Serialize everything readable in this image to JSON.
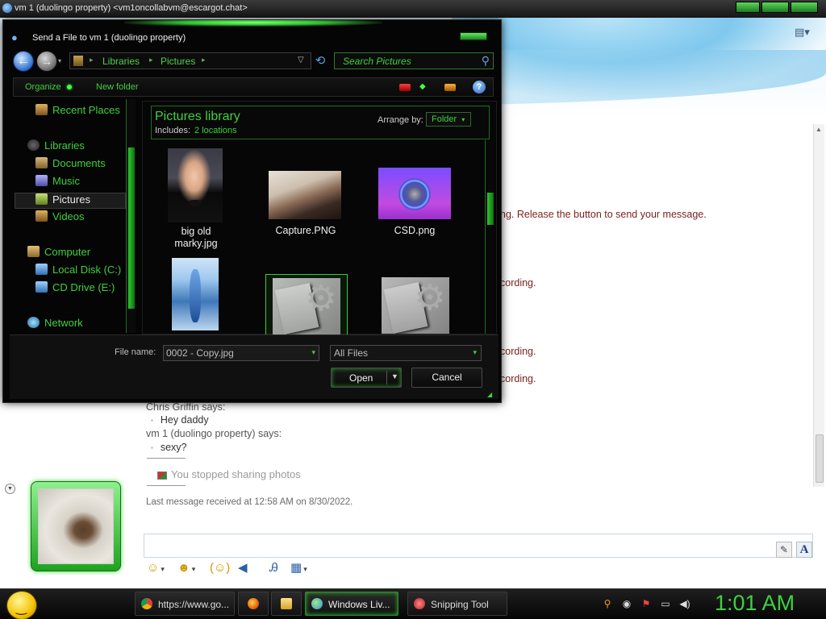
{
  "window": {
    "title": "vm 1 (duolingo property) <vm1oncollabvm@escargot.chat>"
  },
  "chat": {
    "system_messages": [
      "ng. Release the button to send your message.",
      "cording.",
      "cording.",
      "cording."
    ],
    "messages": [
      {
        "sender": "Chris Griffin says:",
        "text": "Hey daddy"
      },
      {
        "sender": "vm 1 (duolingo property) says:",
        "text": "sexy?"
      }
    ],
    "info": "You stopped sharing photos",
    "last_received": "Last message received at 12:58 AM on 8/30/2022."
  },
  "dialog": {
    "title": "Send a File to vm 1 (duolingo property)",
    "breadcrumb": [
      "Libraries",
      "Pictures"
    ],
    "search_placeholder": "Search Pictures",
    "toolbar": {
      "organize": "Organize",
      "new_folder": "New folder"
    },
    "nav": {
      "recent": "Recent Places",
      "libraries": "Libraries",
      "documents": "Documents",
      "music": "Music",
      "pictures": "Pictures",
      "videos": "Videos",
      "computer": "Computer",
      "local_disk": "Local Disk (C:)",
      "cd_drive": "CD Drive (E:)",
      "network": "Network"
    },
    "library": {
      "title": "Pictures library",
      "includes_label": "Includes:",
      "includes_value": "2 locations",
      "arrange_label": "Arrange by:",
      "arrange_value": "Folder"
    },
    "files": {
      "f1": "big old marky.jpg",
      "f2": "Capture.PNG",
      "f3": "CSD.png"
    },
    "filename_label": "File name:",
    "filename_value": "0002 - Copy.jpg",
    "filetype_value": "All Files",
    "open": "Open",
    "cancel": "Cancel"
  },
  "taskbar": {
    "items": [
      {
        "label": "https://www.go...",
        "icon": "chrome-icon"
      },
      {
        "label": "",
        "icon": "firefox-icon"
      },
      {
        "label": "",
        "icon": "folder-icon"
      },
      {
        "label": "Windows Liv...",
        "icon": "messenger-icon"
      },
      {
        "label": "Snipping Tool",
        "icon": "scissors-icon"
      }
    ],
    "clock": "1:01 AM"
  }
}
